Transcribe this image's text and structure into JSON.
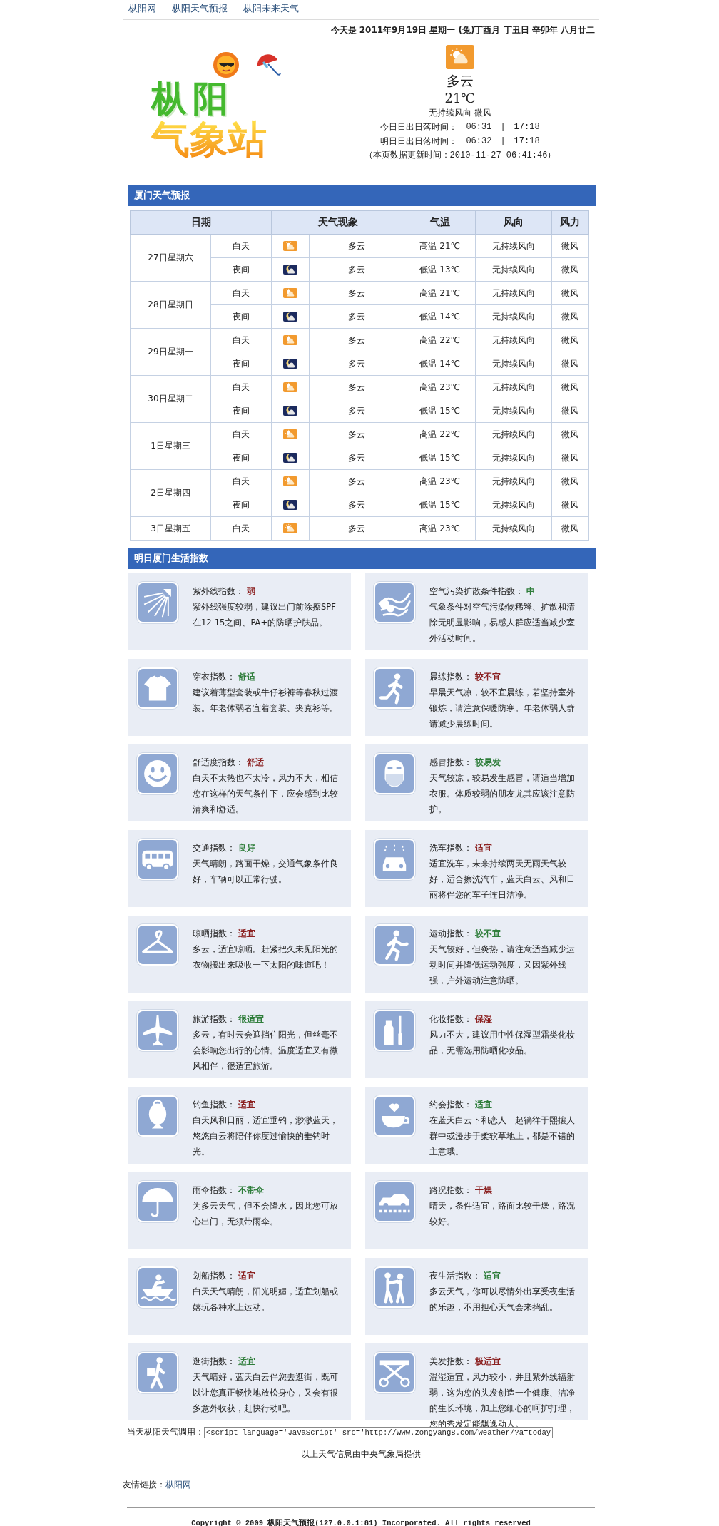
{
  "nav": [
    {
      "label": "枞阳网"
    },
    {
      "label": "枞阳天气预报"
    },
    {
      "label": "枞阳未来天气"
    }
  ],
  "date_line": "今天是  2011年9月19日 星期一 (兔)丁酉月 丁丑日 辛卯年 八月廿二",
  "logo": {
    "line1": "枞阳",
    "line2": "气象站"
  },
  "current": {
    "condition": "多云",
    "temperature": "21℃",
    "wind": "无持续风向 微风",
    "sun_times": [
      {
        "label": "今日日出日落时间：",
        "sunrise": "06:31",
        "separator": "|",
        "sunset": "17:18"
      },
      {
        "label": "明日日出日落时间：",
        "sunrise": "06:32",
        "separator": "|",
        "sunset": "17:18"
      }
    ],
    "updated": "（本页数据更新时间：2010-11-27 06:41:46）"
  },
  "forecast": {
    "title": "厦门天气预报",
    "columns": [
      "日期",
      "天气现象",
      "气温",
      "风向",
      "风力"
    ],
    "days": [
      {
        "date": "27日星期六",
        "periods": [
          {
            "kind": "day",
            "period": "白天",
            "condition": "多云",
            "temperature": "高温 21℃",
            "wind_direction": "无持续风向",
            "wind_force": "微风"
          },
          {
            "kind": "night",
            "period": "夜间",
            "condition": "多云",
            "temperature": "低温 13℃",
            "wind_direction": "无持续风向",
            "wind_force": "微风"
          }
        ]
      },
      {
        "date": "28日星期日",
        "periods": [
          {
            "kind": "day",
            "period": "白天",
            "condition": "多云",
            "temperature": "高温 21℃",
            "wind_direction": "无持续风向",
            "wind_force": "微风"
          },
          {
            "kind": "night",
            "period": "夜间",
            "condition": "多云",
            "temperature": "低温 14℃",
            "wind_direction": "无持续风向",
            "wind_force": "微风"
          }
        ]
      },
      {
        "date": "29日星期一",
        "periods": [
          {
            "kind": "day",
            "period": "白天",
            "condition": "多云",
            "temperature": "高温 22℃",
            "wind_direction": "无持续风向",
            "wind_force": "微风"
          },
          {
            "kind": "night",
            "period": "夜间",
            "condition": "多云",
            "temperature": "低温 14℃",
            "wind_direction": "无持续风向",
            "wind_force": "微风"
          }
        ]
      },
      {
        "date": "30日星期二",
        "periods": [
          {
            "kind": "day",
            "period": "白天",
            "condition": "多云",
            "temperature": "高温 23℃",
            "wind_direction": "无持续风向",
            "wind_force": "微风"
          },
          {
            "kind": "night",
            "period": "夜间",
            "condition": "多云",
            "temperature": "低温 15℃",
            "wind_direction": "无持续风向",
            "wind_force": "微风"
          }
        ]
      },
      {
        "date": "1日星期三",
        "periods": [
          {
            "kind": "day",
            "period": "白天",
            "condition": "多云",
            "temperature": "高温 22℃",
            "wind_direction": "无持续风向",
            "wind_force": "微风"
          },
          {
            "kind": "night",
            "period": "夜间",
            "condition": "多云",
            "temperature": "低温 15℃",
            "wind_direction": "无持续风向",
            "wind_force": "微风"
          }
        ]
      },
      {
        "date": "2日星期四",
        "periods": [
          {
            "kind": "day",
            "period": "白天",
            "condition": "多云",
            "temperature": "高温 23℃",
            "wind_direction": "无持续风向",
            "wind_force": "微风"
          },
          {
            "kind": "night",
            "period": "夜间",
            "condition": "多云",
            "temperature": "低温 15℃",
            "wind_direction": "无持续风向",
            "wind_force": "微风"
          }
        ]
      },
      {
        "date": "3日星期五",
        "periods": [
          {
            "kind": "day",
            "period": "白天",
            "condition": "多云",
            "temperature": "高温 23℃",
            "wind_direction": "无持续风向",
            "wind_force": "微风"
          }
        ]
      }
    ]
  },
  "life": {
    "title": "明日厦门生活指数",
    "items": [
      {
        "label": "紫外线指数：",
        "value": "弱",
        "color": "#8b2020",
        "text": "紫外线强度较弱，建议出门前涂擦SPF在12-15之间、PA+的防晒护肤品。"
      },
      {
        "label": "空气污染扩散条件指数：",
        "value": "中",
        "color": "#2e7d3a",
        "text": "气象条件对空气污染物稀释、扩散和清除无明显影响，易感人群应适当减少室外活动时间。"
      },
      {
        "label": "穿衣指数：",
        "value": "舒适",
        "color": "#2e7d3a",
        "text": "建议着薄型套装或牛仔衫裤等春秋过渡装。年老体弱者宜着套装、夹克衫等。"
      },
      {
        "label": "晨练指数：",
        "value": "较不宜",
        "color": "#8b2020",
        "text": "早晨天气凉，较不宜晨练，若坚持室外锻炼，请注意保暖防寒。年老体弱人群请减少晨练时间。"
      },
      {
        "label": "舒适度指数：",
        "value": "舒适",
        "color": "#8b2020",
        "text": "白天不太热也不太冷，风力不大，相信您在这样的天气条件下，应会感到比较清爽和舒适。"
      },
      {
        "label": "感冒指数：",
        "value": "较易发",
        "color": "#2e7d3a",
        "text": "天气较凉，较易发生感冒，请适当增加衣服。体质较弱的朋友尤其应该注意防护。"
      },
      {
        "label": "交通指数：",
        "value": "良好",
        "color": "#2e7d3a",
        "text": "天气晴朗，路面干燥，交通气象条件良好，车辆可以正常行驶。"
      },
      {
        "label": "洗车指数：",
        "value": "适宜",
        "color": "#8b2020",
        "text": "适宜洗车，未来持续两天无雨天气较好，适合擦洗汽车，蓝天白云、风和日丽将伴您的车子连日洁净。"
      },
      {
        "label": "晾晒指数：",
        "value": "适宜",
        "color": "#8b2020",
        "text": "多云，适宜晾晒。赶紧把久未见阳光的衣物搬出来吸收一下太阳的味道吧！"
      },
      {
        "label": "运动指数：",
        "value": "较不宜",
        "color": "#2e7d3a",
        "text": "天气较好，但炎热，请注意适当减少运动时间并降低运动强度，又因紫外线强，户外运动注意防晒。"
      },
      {
        "label": "旅游指数：",
        "value": "很适宜",
        "color": "#2e7d3a",
        "text": "多云，有时云会遮挡住阳光，但丝毫不会影响您出行的心情。温度适宜又有微风相伴，很适宜旅游。"
      },
      {
        "label": "化妆指数：",
        "value": "保湿",
        "color": "#8b2020",
        "text": "风力不大，建议用中性保湿型霜类化妆品，无需选用防晒化妆品。"
      },
      {
        "label": "钓鱼指数：",
        "value": "适宜",
        "color": "#8b2020",
        "text": "白天风和日丽，适宜垂钓，渺渺蓝天，悠悠白云将陪伴你度过愉快的垂钓时光。"
      },
      {
        "label": "约会指数：",
        "value": "适宜",
        "color": "#2e7d3a",
        "text": "在蓝天白云下和恋人一起徜徉于熙攘人群中或漫步于柔软草地上，都是不错的主意哦。"
      },
      {
        "label": "雨伞指数：",
        "value": "不带伞",
        "color": "#2e7d3a",
        "text": "为多云天气，但不会降水，因此您可放心出门，无须带雨伞。"
      },
      {
        "label": "路况指数：",
        "value": "干燥",
        "color": "#8b2020",
        "text": "晴天，条件适宜，路面比较干燥，路况较好。"
      },
      {
        "label": "划船指数：",
        "value": "适宜",
        "color": "#8b2020",
        "text": "白天天气晴朗，阳光明媚，适宜划船或嬉玩各种水上运动。"
      },
      {
        "label": "夜生活指数：",
        "value": "适宜",
        "color": "#2e7d3a",
        "text": "多云天气，你可以尽情外出享受夜生活的乐趣，不用担心天气会来捣乱。"
      },
      {
        "label": "逛街指数：",
        "value": "适宜",
        "color": "#2e7d3a",
        "text": "天气晴好，蓝天白云伴您去逛街，既可以让您真正畅快地放松身心，又会有很多意外收获，赶快行动吧。"
      },
      {
        "label": "美发指数：",
        "value": "极适宜",
        "color": "#8b2020",
        "text": "温湿适宜，风力较小，并且紫外线辐射弱，这为您的头发创造一个健康、洁净的生长环境，加上您细心的呵护打理，您的秀发定能飘逸动人。"
      }
    ]
  },
  "embed": {
    "label": "当天枞阳天气调用：",
    "value": "<script language='JavaScript' src='http://www.zongyang8.com/weather/?a=today"
  },
  "source_note": "以上天气信息由中央气象局提供",
  "links": {
    "label": "友情链接：",
    "items": [
      "枞阳网"
    ]
  },
  "copyright": "Copyright © 2009 枞阳天气预报(127.0.0.1:81) Incorporated. All rights reserved"
}
